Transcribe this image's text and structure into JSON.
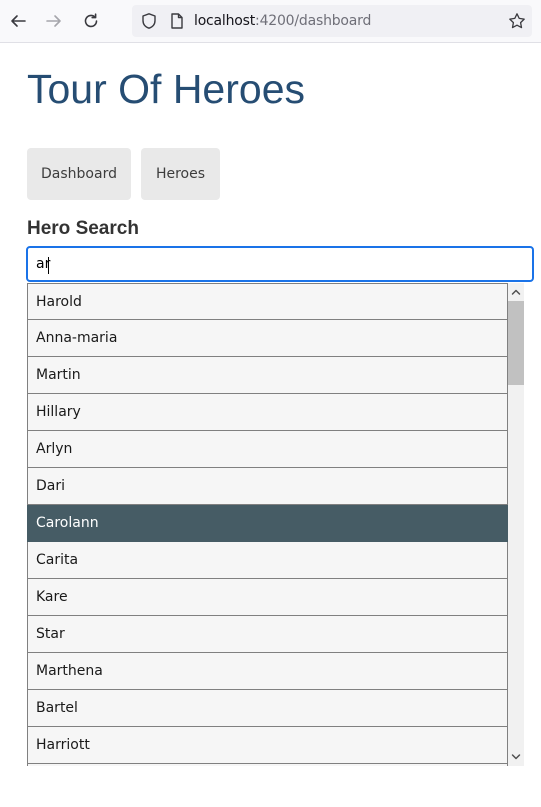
{
  "browser": {
    "url_host": "localhost",
    "url_rest": ":4200/dashboard"
  },
  "page": {
    "title": "Tour Of Heroes",
    "nav": [
      {
        "label": "Dashboard"
      },
      {
        "label": "Heroes"
      }
    ]
  },
  "search": {
    "title": "Hero Search",
    "query": "ar",
    "results": [
      {
        "name": "Harold"
      },
      {
        "name": "Anna-maria"
      },
      {
        "name": "Martin"
      },
      {
        "name": "Hillary"
      },
      {
        "name": "Arlyn"
      },
      {
        "name": "Dari"
      },
      {
        "name": "Carolann"
      },
      {
        "name": "Carita"
      },
      {
        "name": "Kare"
      },
      {
        "name": "Star"
      },
      {
        "name": "Marthena"
      },
      {
        "name": "Bartel"
      },
      {
        "name": "Harriott"
      },
      {
        "name": ""
      }
    ],
    "highlighted": "Carolann"
  },
  "colors": {
    "title": "#264d73",
    "highlight_bg": "#465c65",
    "focus_border": "#1a73e8"
  },
  "icons": [
    "back-icon",
    "forward-icon",
    "reload-icon",
    "shield-icon",
    "page-icon",
    "bookmark-star-icon"
  ]
}
